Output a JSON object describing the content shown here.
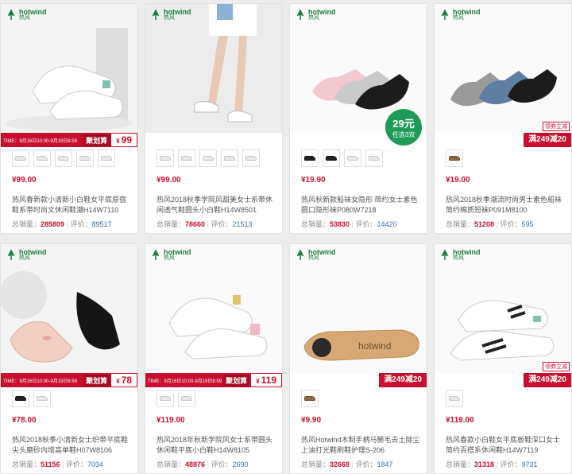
{
  "brand": {
    "name_en": "hotwind",
    "name_cn": "热风"
  },
  "labels": {
    "sold": "总销量：",
    "reviews": "评价：",
    "yen": "¥"
  },
  "products": [
    {
      "ribbon_time": "TIME：9月16日10:00-9月19日8:59",
      "ribbon_badge": "聚划算",
      "ribbon_price": "99",
      "price": "¥99.00",
      "title": "热风春新款小清新小白鞋女平底原宿鞋系带时尚文休闲鞋潮H14W7110",
      "sold": "285809",
      "reviews": "89517",
      "thumbs": [
        "white",
        "white",
        "white",
        "white",
        "white"
      ]
    },
    {
      "price": "¥99.00",
      "title": "热风2018秋季学院风甜美女士系带休闲透气鞋圆头小白鞋H14W8501",
      "sold": "78660",
      "reviews": "21513",
      "thumbs": [
        "white",
        "white",
        "white",
        "white",
        "white"
      ]
    },
    {
      "promo_circle_price": "29元",
      "promo_circle_sub": "任选3双",
      "price": "¥19.90",
      "title": "热风秋新款船袜女隐形 简约女士素色圆口隐形袜P080W7218",
      "sold": "53830",
      "reviews": "14420",
      "thumbs": [
        "dark",
        "dark",
        "white",
        "white"
      ]
    },
    {
      "promo_tag": "领券立减",
      "promo_bar": "满249减20",
      "price": "¥19.00",
      "title": "热风2018秋季潮流时尚男士素色船袜简约棉质短袜P091M8100",
      "sold": "51208",
      "reviews": "595",
      "thumbs": [
        "tan"
      ]
    },
    {
      "ribbon_time": "TIME：9月16日10:00-9月19日8:59",
      "ribbon_badge": "聚划算",
      "ribbon_price": "78",
      "price": "¥78.00",
      "title": "热风2018秋季小清新女士织带平底鞋尖头磨砂内增高单鞋H07W8106",
      "sold": "51156",
      "reviews": "7034",
      "thumbs": [
        "dark",
        "white"
      ]
    },
    {
      "ribbon_time": "TIME：9月16日10:00-9月19日8:59",
      "ribbon_badge": "聚划算",
      "ribbon_price": "119",
      "price": "¥119.00",
      "title": "热风2018年秋新学院风女士系带圆头休闲鞋平底小白鞋H14W8105",
      "sold": "48876",
      "reviews": "2690",
      "thumbs": [
        "white",
        "white"
      ]
    },
    {
      "promo_bar": "满249减20",
      "price": "¥9.90",
      "title": "热风Hotwind木制手柄马鬃毛去土除尘上油打光鞋刷鞋护理S-206",
      "sold": "32668",
      "reviews": "1847",
      "thumbs": [
        "tan"
      ]
    },
    {
      "promo_tag": "领券立减",
      "promo_bar": "满249减20",
      "price": "¥119.00",
      "title": "热风春款小白鞋女平底板鞋深口女士简约百搭系休闲鞋H14W7119",
      "sold": "31318",
      "reviews": "9731",
      "thumbs": [
        "white"
      ]
    }
  ],
  "colors": {
    "accent": "#c8102e",
    "brand_green": "#1a7d3c",
    "promo_green": "#1e9b57",
    "review_blue": "#3b6ea5"
  }
}
